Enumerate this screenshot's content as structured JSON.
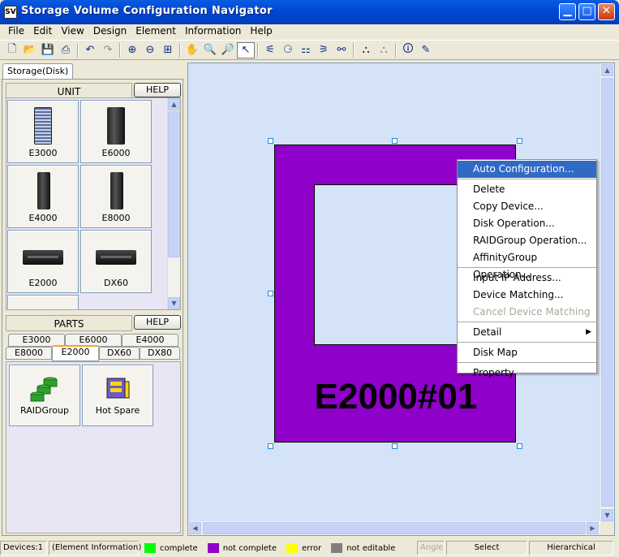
{
  "window": {
    "title": "Storage Volume Configuration Navigator",
    "icon_text": "SV",
    "controls": [
      "minimize-icon",
      "maximize-icon",
      "close-icon"
    ]
  },
  "menu": [
    "File",
    "Edit",
    "View",
    "Design",
    "Element",
    "Information",
    "Help"
  ],
  "toolbar": {
    "buttons": [
      {
        "name": "new-icon",
        "glyph": "🗋"
      },
      {
        "name": "open-icon",
        "glyph": "📂"
      },
      {
        "name": "save-icon",
        "glyph": "💾"
      },
      {
        "name": "print-icon",
        "glyph": "⎙"
      },
      {
        "name": "undo-icon",
        "glyph": "↶"
      },
      {
        "name": "redo-icon",
        "glyph": "↷"
      },
      {
        "name": "zoom-in-icon",
        "glyph": "⊕"
      },
      {
        "name": "zoom-out-icon",
        "glyph": "⊖"
      },
      {
        "name": "fit-icon",
        "glyph": "⊞"
      },
      {
        "name": "hand-icon",
        "glyph": "✋"
      },
      {
        "name": "zoom-area-icon",
        "glyph": "🔍"
      },
      {
        "name": "zoom-select-icon",
        "glyph": "🔎"
      },
      {
        "name": "pointer-icon",
        "glyph": "↖"
      },
      {
        "name": "layout-tree-icon",
        "glyph": "⚟"
      },
      {
        "name": "layout-circle-icon",
        "glyph": "⚆"
      },
      {
        "name": "layout-grid-icon",
        "glyph": "⚏"
      },
      {
        "name": "layout-hier-icon",
        "glyph": "⚞"
      },
      {
        "name": "layout-free-icon",
        "glyph": "⚯"
      },
      {
        "name": "hierarchy-icon",
        "glyph": "⛬"
      },
      {
        "name": "hierarchy-gray-icon",
        "glyph": "⛬"
      },
      {
        "name": "info-icon",
        "glyph": "🛈"
      },
      {
        "name": "info-edit-icon",
        "glyph": "✎"
      }
    ]
  },
  "left_panel": {
    "tab": "Storage(Disk)",
    "unit": {
      "title": "UNIT",
      "help": "HELP",
      "items": [
        "E3000",
        "E6000",
        "E4000",
        "E8000",
        "E2000",
        "DX60"
      ]
    },
    "parts": {
      "title": "PARTS",
      "help": "HELP",
      "tabs_row1": [
        "E3000",
        "E6000",
        "E4000"
      ],
      "tabs_row2": [
        "E8000",
        "E2000",
        "DX60",
        "DX80"
      ],
      "selected_tab": "E2000",
      "items": [
        "RAIDGroup",
        "Hot Spare"
      ]
    }
  },
  "canvas": {
    "device_label": "E2000#01",
    "device_color": "#8f00c8"
  },
  "context_menu": {
    "groups": [
      [
        {
          "label": "Auto Configuration...",
          "state": "highlighted"
        }
      ],
      [
        {
          "label": "Delete",
          "state": "normal"
        },
        {
          "label": "Copy Device...",
          "state": "normal"
        },
        {
          "label": "Disk Operation...",
          "state": "normal"
        },
        {
          "label": "RAIDGroup Operation...",
          "state": "normal"
        },
        {
          "label": "AffinityGroup Operation...",
          "state": "normal"
        }
      ],
      [
        {
          "label": "Input IP Address...",
          "state": "normal"
        },
        {
          "label": "Device Matching...",
          "state": "normal"
        },
        {
          "label": "Cancel Device Matching",
          "state": "disabled"
        }
      ],
      [
        {
          "label": "Detail",
          "state": "normal",
          "submenu": true
        }
      ],
      [
        {
          "label": "Disk Map",
          "state": "normal"
        }
      ],
      [
        {
          "label": "Property",
          "state": "normal"
        }
      ]
    ]
  },
  "statusbar": {
    "devices": "Devices:1",
    "element_info": "(Element Information)",
    "legend": [
      {
        "label": "complete",
        "color": "#00ff00"
      },
      {
        "label": "not complete",
        "color": "#8f00c8"
      },
      {
        "label": "error",
        "color": "#ffff00"
      },
      {
        "label": "not editable",
        "color": "#808080"
      }
    ],
    "angle": "Angle",
    "mode": "Select",
    "layout": "Hierarchical"
  }
}
